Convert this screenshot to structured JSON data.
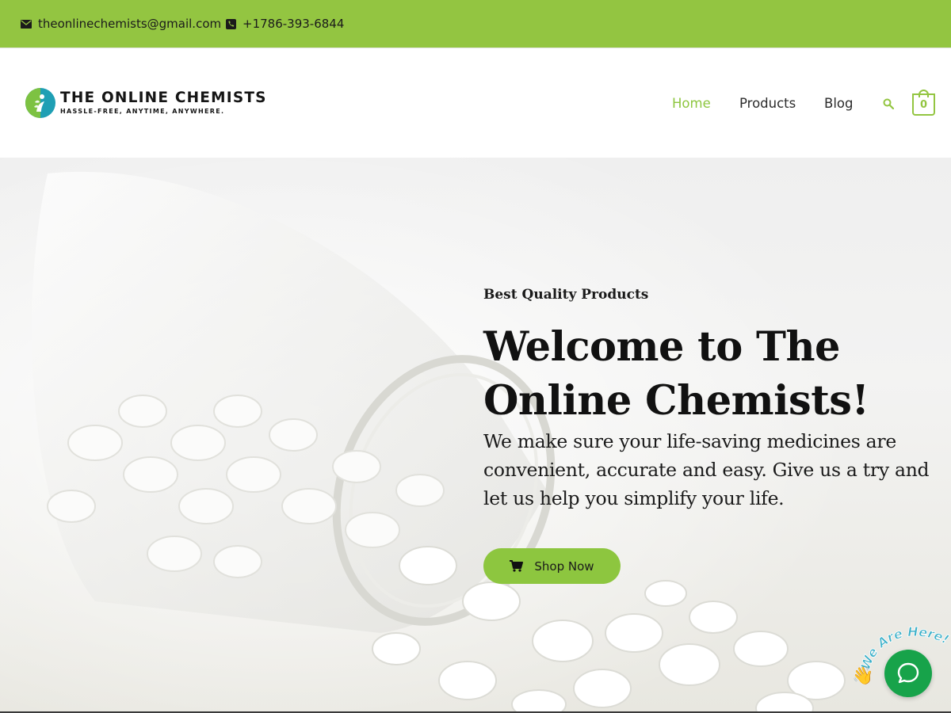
{
  "topbar": {
    "email": "theonlinechemists@gmail.com",
    "phone": "+1786-393-6844",
    "email_icon": "envelope-icon",
    "phone_icon": "phone-icon",
    "background": "#93c541"
  },
  "header": {
    "logo_title": "THE ONLINE CHEMISTS",
    "logo_tagline": "HASSLE-FREE, ANYTIME, ANYWHERE.",
    "nav": {
      "home": "Home",
      "products": "Products",
      "blog": "Blog"
    },
    "active_nav": "Home",
    "search_icon": "search-icon",
    "cart_count": "0",
    "accent": "#8dc63f"
  },
  "hero": {
    "eyebrow": "Best Quality Products",
    "title": "Welcome to The Online Chemists!",
    "text": "We make sure your life-saving medicines are convenient, accurate and easy. Give us a try and let us help you simplify your life.",
    "button_label": "Shop Now",
    "button_icon": "cart-icon"
  },
  "chat": {
    "label": "We Are Here!",
    "wave_icon": "waving-hand-icon",
    "bubble_icon": "chat-bubble-icon",
    "color": "#17a34a"
  }
}
